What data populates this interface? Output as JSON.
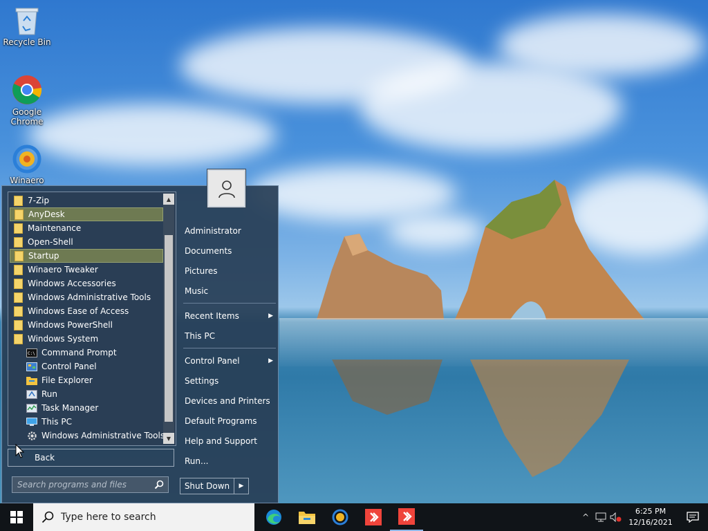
{
  "desktop": {
    "icons": [
      {
        "label": "Recycle Bin"
      },
      {
        "label": "Google Chrome"
      },
      {
        "label": "Winaero"
      }
    ]
  },
  "start_menu": {
    "programs": [
      {
        "label": "7-Zip",
        "type": "folder"
      },
      {
        "label": "AnyDesk",
        "type": "folder",
        "selected": true
      },
      {
        "label": "Maintenance",
        "type": "folder"
      },
      {
        "label": "Open-Shell",
        "type": "folder"
      },
      {
        "label": "Startup",
        "type": "folder",
        "selected": true
      },
      {
        "label": "Winaero Tweaker",
        "type": "folder"
      },
      {
        "label": "Windows Accessories",
        "type": "folder"
      },
      {
        "label": "Windows Administrative Tools",
        "type": "folder"
      },
      {
        "label": "Windows Ease of Access",
        "type": "folder"
      },
      {
        "label": "Windows PowerShell",
        "type": "folder"
      },
      {
        "label": "Windows System",
        "type": "folder"
      },
      {
        "label": "Command Prompt",
        "type": "item",
        "icon": "command-prompt-icon"
      },
      {
        "label": "Control Panel",
        "type": "item",
        "icon": "control-panel-icon"
      },
      {
        "label": "File Explorer",
        "type": "item",
        "icon": "file-explorer-icon"
      },
      {
        "label": "Run",
        "type": "item",
        "icon": "run-icon"
      },
      {
        "label": "Task Manager",
        "type": "item",
        "icon": "task-manager-icon"
      },
      {
        "label": "This PC",
        "type": "item",
        "icon": "this-pc-icon"
      },
      {
        "label": "Windows Administrative Tools",
        "type": "item",
        "icon": "gear-icon"
      }
    ],
    "back_label": "Back",
    "search_placeholder": "Search programs and files",
    "right_items": [
      {
        "label": "Administrator"
      },
      {
        "label": "Documents"
      },
      {
        "label": "Pictures"
      },
      {
        "label": "Music"
      },
      {
        "sep": true
      },
      {
        "label": "Recent Items",
        "arrow": true
      },
      {
        "label": "This PC"
      },
      {
        "sep": true
      },
      {
        "label": "Control Panel",
        "arrow": true
      },
      {
        "label": "Settings"
      },
      {
        "label": "Devices and Printers"
      },
      {
        "label": "Default Programs"
      },
      {
        "label": "Help and Support"
      },
      {
        "label": "Run..."
      }
    ],
    "shutdown_label": "Shut Down",
    "selection_color": "#6e7a52"
  },
  "taskbar": {
    "search_placeholder": "Type here to search",
    "time": "6:25 PM",
    "date": "12/16/2021",
    "background": "#101418"
  }
}
